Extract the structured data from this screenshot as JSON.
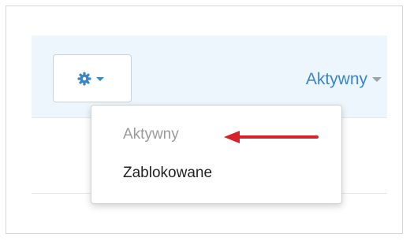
{
  "toolbar": {
    "settings_icon": "gear-icon",
    "status_label": "Aktywny"
  },
  "dropdown": {
    "items": [
      {
        "label": "Aktywny",
        "state": "selected"
      },
      {
        "label": "Zablokowane",
        "state": "default"
      }
    ]
  },
  "colors": {
    "accent": "#3b86c6",
    "header_bg": "#eef6fd",
    "annotation_arrow": "#d6212b",
    "muted_text": "#9a9a9a"
  }
}
